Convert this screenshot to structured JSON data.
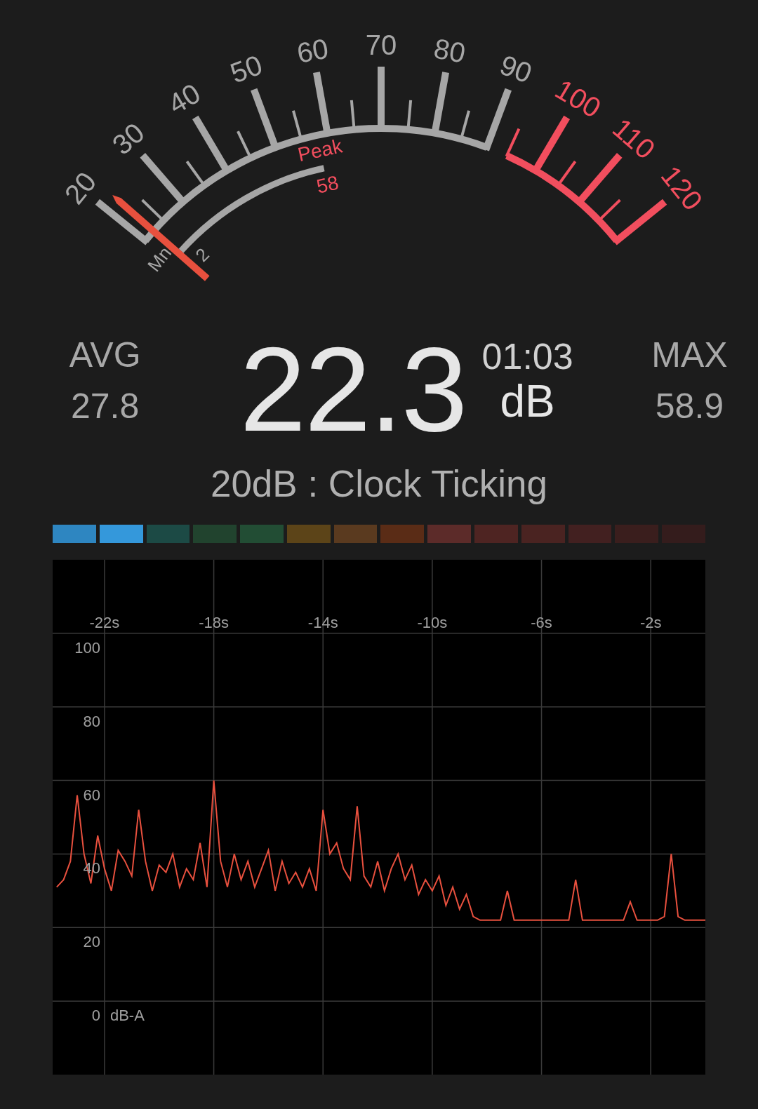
{
  "gauge": {
    "scale_labels": [
      {
        "text": "20",
        "kind": "normal"
      },
      {
        "text": "30",
        "kind": "normal"
      },
      {
        "text": "40",
        "kind": "normal"
      },
      {
        "text": "50",
        "kind": "normal"
      },
      {
        "text": "60",
        "kind": "normal"
      },
      {
        "text": "70",
        "kind": "normal"
      },
      {
        "text": "80",
        "kind": "normal"
      },
      {
        "text": "90",
        "kind": "normal"
      },
      {
        "text": "100",
        "kind": "alarm"
      },
      {
        "text": "110",
        "kind": "alarm"
      },
      {
        "text": "120",
        "kind": "alarm"
      }
    ],
    "peak": {
      "label": "Peak",
      "value": "58"
    },
    "min": {
      "label": "Mn",
      "value": "2"
    }
  },
  "readouts": {
    "avg_label": "AVG",
    "avg_value": "27.8",
    "current": "22.3",
    "elapsed": "01:03",
    "unit": "dB",
    "max_label": "MAX",
    "max_value": "58.9"
  },
  "description": "20dB : Clock Ticking",
  "level_bar": [
    {
      "color": "#2e86c1"
    },
    {
      "color": "#3498db"
    },
    {
      "color": "#1c4a45"
    },
    {
      "color": "#21432e"
    },
    {
      "color": "#224d34"
    },
    {
      "color": "#5c4418"
    },
    {
      "color": "#5a3a1f"
    },
    {
      "color": "#5a2c16"
    },
    {
      "color": "#5c2b29"
    },
    {
      "color": "#4e2422"
    },
    {
      "color": "#4a2321"
    },
    {
      "color": "#422020"
    },
    {
      "color": "#3a1e1d"
    },
    {
      "color": "#341c1c"
    }
  ],
  "history": {
    "chart_data": {
      "type": "line",
      "ylabel": "dB-A",
      "grid": true,
      "xlim": [
        -23.9,
        0
      ],
      "ylim": [
        -20,
        120
      ],
      "xticks": [
        {
          "value": -22,
          "label": "-22s"
        },
        {
          "value": -18,
          "label": "-18s"
        },
        {
          "value": -14,
          "label": "-14s"
        },
        {
          "value": -10,
          "label": "-10s"
        },
        {
          "value": -6,
          "label": "-6s"
        },
        {
          "value": -2,
          "label": "-2s"
        }
      ],
      "yticks": [
        0,
        20,
        40,
        60,
        80,
        100
      ],
      "x": [
        -23.75,
        -23.5,
        -23.25,
        -23,
        -22.75,
        -22.5,
        -22.25,
        -22,
        -21.75,
        -21.5,
        -21.25,
        -21,
        -20.75,
        -20.5,
        -20.25,
        -20,
        -19.75,
        -19.5,
        -19.25,
        -19,
        -18.75,
        -18.5,
        -18.25,
        -18,
        -17.75,
        -17.5,
        -17.25,
        -17,
        -16.75,
        -16.5,
        -16.25,
        -16,
        -15.75,
        -15.5,
        -15.25,
        -15,
        -14.75,
        -14.5,
        -14.25,
        -14,
        -13.75,
        -13.5,
        -13.25,
        -13,
        -12.75,
        -12.5,
        -12.25,
        -12,
        -11.75,
        -11.5,
        -11.25,
        -11,
        -10.75,
        -10.5,
        -10.25,
        -10,
        -9.75,
        -9.5,
        -9.25,
        -9,
        -8.75,
        -8.5,
        -8.25,
        -8,
        -7.75,
        -7.5,
        -7.25,
        -7,
        -6.75,
        -6.5,
        -6.25,
        -6,
        -5.75,
        -5.5,
        -5.25,
        -5,
        -4.75,
        -4.5,
        -4.25,
        -4,
        -3.75,
        -3.5,
        -3.25,
        -3,
        -2.75,
        -2.5,
        -2.25,
        -2,
        -1.75,
        -1.5,
        -1.25,
        -1,
        -0.75,
        -0.5,
        -0.25,
        0
      ],
      "series": [
        {
          "color": "#e8503e",
          "values": [
            31,
            33,
            38,
            56,
            40,
            32,
            45,
            36,
            30,
            41,
            38,
            34,
            52,
            38,
            30,
            37,
            35,
            40,
            31,
            36,
            33,
            43,
            31,
            60,
            38,
            31,
            40,
            33,
            38,
            31,
            36,
            41,
            30,
            38,
            32,
            35,
            31,
            36,
            30,
            52,
            40,
            43,
            36,
            33,
            53,
            34,
            31,
            38,
            30,
            36,
            40,
            33,
            37,
            29,
            33,
            30,
            34,
            26,
            31,
            25,
            29,
            23,
            22,
            22,
            22,
            22,
            30,
            22,
            22,
            22,
            22,
            22,
            22,
            22,
            22,
            22,
            33,
            22,
            22,
            22,
            22,
            22,
            22,
            22,
            27,
            22,
            22,
            22,
            22,
            23,
            40,
            23,
            22,
            22,
            22,
            22
          ]
        }
      ]
    }
  }
}
